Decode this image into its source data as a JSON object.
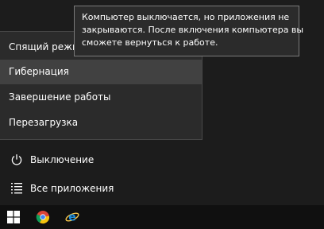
{
  "power_menu": {
    "items": [
      {
        "label": "Спящий режим"
      },
      {
        "label": "Гибернация",
        "highlighted": true
      },
      {
        "label": "Завершение работы"
      },
      {
        "label": "Перезагрузка"
      }
    ]
  },
  "tooltip": {
    "lines": [
      "Компьютер выключается, но приложения не",
      "закрываются. После включения компьютера вы",
      "сможете вернуться к работе."
    ]
  },
  "start_menu": {
    "power_label": "Выключение",
    "all_apps_label": "Все приложения"
  },
  "taskbar": {
    "icons": [
      "windows-start-icon",
      "chrome-icon",
      "internet-explorer-icon"
    ]
  },
  "colors": {
    "menu_bg": "#2b2b2b",
    "highlight": "#414141",
    "taskbar_bg": "#101010",
    "ie_blue": "#1e90e0"
  }
}
